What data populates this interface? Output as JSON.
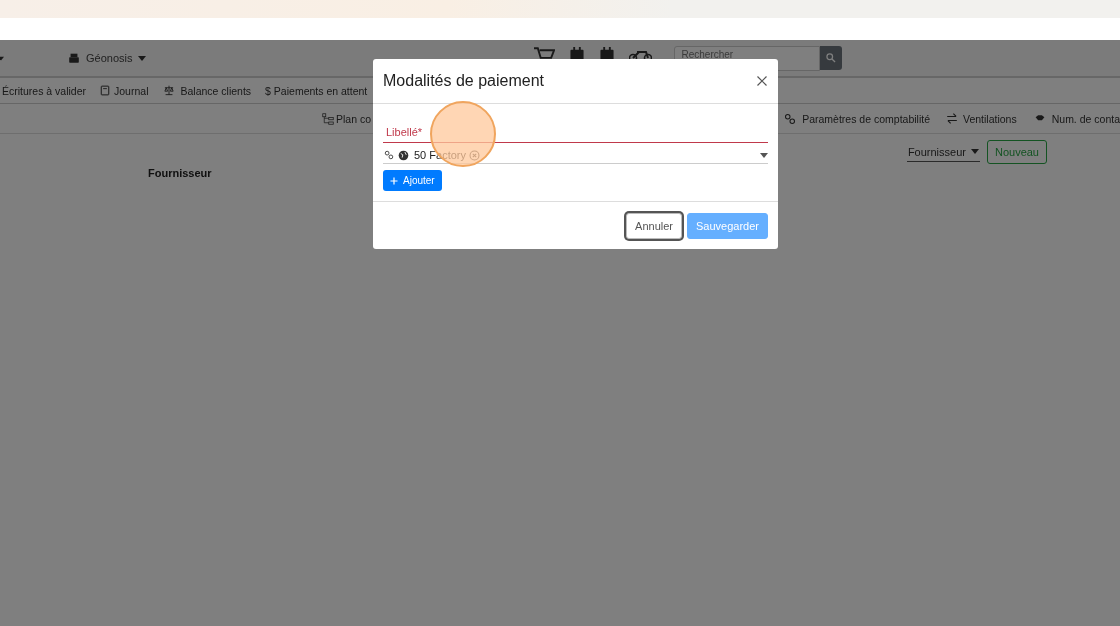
{
  "navbar": {
    "workspace": "Géonosis",
    "search": {
      "placeholder": "Rechercher"
    }
  },
  "nav": [
    "Écritures à valider",
    "Journal",
    "Balance clients",
    "$ Paiements en attent"
  ],
  "subnav": [
    "Plan co",
    "Paramètres de comptabilité",
    "Ventilations",
    "Num. de conta"
  ],
  "toolbar": {
    "filter": "Fournisseur",
    "new_button": "Nouveau"
  },
  "column_header": "Fournisseur",
  "modal": {
    "title": "Modalités de paiement",
    "field": {
      "label": "Libellé*",
      "invalid": true
    },
    "select": {
      "chips": [
        "50 Factory"
      ]
    },
    "add_button": "Ajouter",
    "buttons": [
      {
        "label": "Annuler",
        "kind": "secondary",
        "focused": true,
        "disabled": false
      },
      {
        "label": "Sauvegarder",
        "kind": "primary",
        "focused": false,
        "disabled": true
      }
    ]
  }
}
